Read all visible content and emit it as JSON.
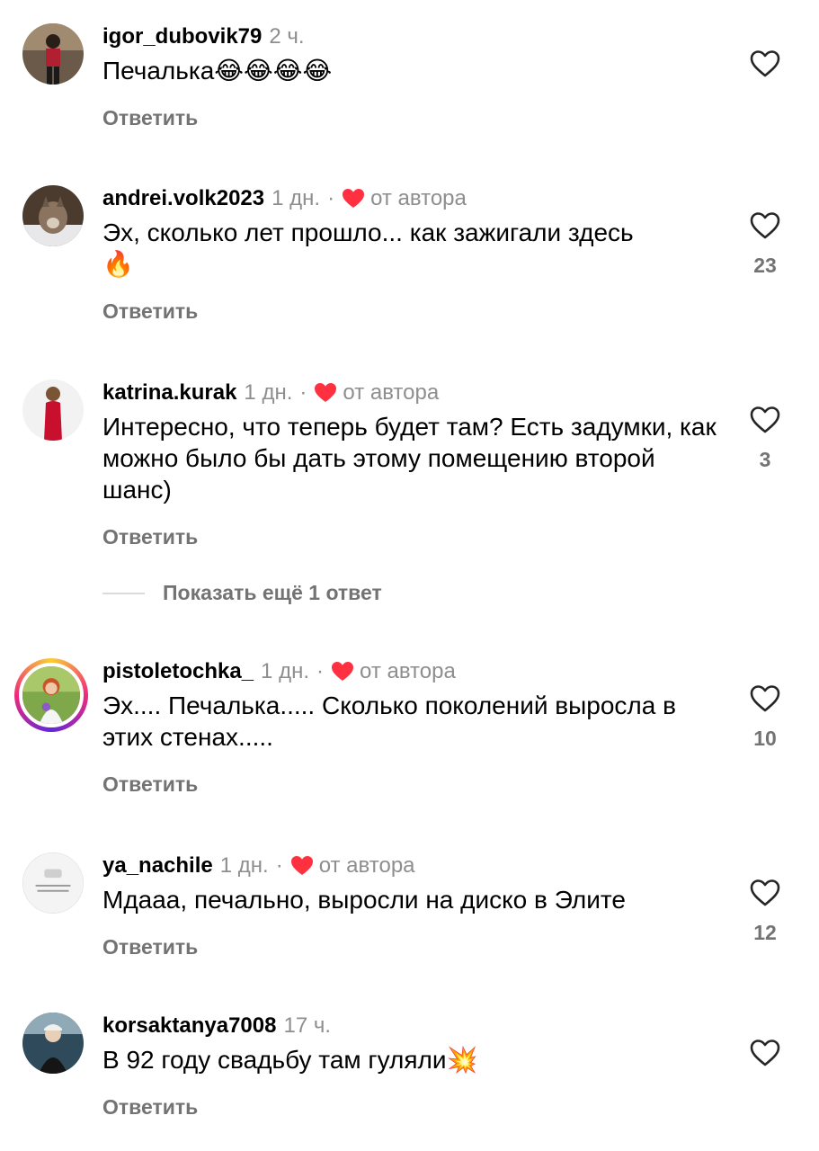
{
  "comments": [
    {
      "username": "igor_dubovik79",
      "time": "2 ч.",
      "author_liked": false,
      "text": "Печалька",
      "emoji_after": "😂😂😂😂",
      "reply_label": "Ответить",
      "likes": ""
    },
    {
      "username": "andrei.volk2023",
      "time": "1 дн.",
      "author_liked": true,
      "author_label": "от автора",
      "text": "Эх, сколько лет прошло... как зажигали здесь",
      "emoji_after": "🔥",
      "reply_label": "Ответить",
      "likes": "23"
    },
    {
      "username": "katrina.kurak",
      "time": "1 дн.",
      "author_liked": true,
      "author_label": "от автора",
      "text": "Интересно, что теперь будет там?  Есть задумки, как можно было бы дать этому помещению второй шанс)",
      "reply_label": "Ответить",
      "likes": "3"
    },
    {
      "username": "pistoletochka_",
      "time": "1 дн.",
      "author_liked": true,
      "author_label": "от автора",
      "text": "Эх.... Печалька..... Сколько поколений выросла в этих стенах.....",
      "reply_label": "Ответить",
      "likes": "10"
    },
    {
      "username": "ya_nachile",
      "time": "1 дн.",
      "author_liked": true,
      "author_label": "от автора",
      "text": "Мдааа, печально, выросли на диско в Элите",
      "reply_label": "Ответить",
      "likes": "12"
    },
    {
      "username": "korsaktanya7008",
      "time": "17 ч.",
      "author_liked": false,
      "text": "В 92 году свадьбу там гуляли",
      "emoji_after": "💥",
      "reply_label": "Ответить",
      "likes": ""
    }
  ],
  "show_more_replies": "Показать ещё 1 ответ",
  "colors": {
    "heart_red": "#ff3040",
    "secondary_text": "#737373",
    "meta_text": "#8e8e8e"
  },
  "icons": {
    "like": "heart-outline-icon",
    "author_like": "heart-filled-icon"
  }
}
